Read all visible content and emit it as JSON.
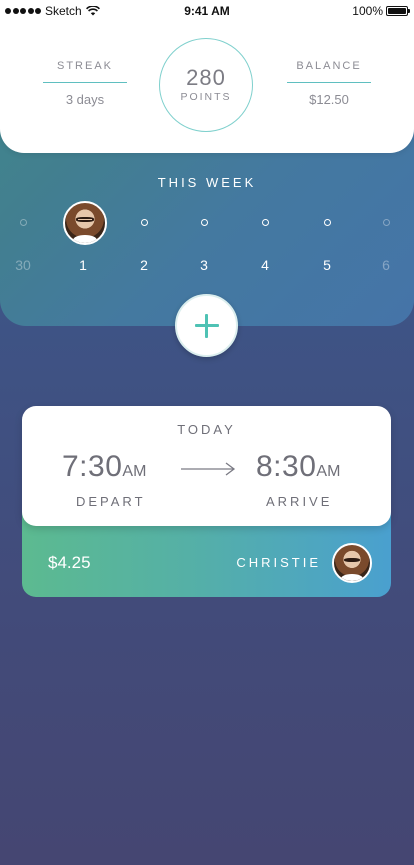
{
  "status_bar": {
    "carrier": "Sketch",
    "time": "9:41 AM",
    "battery": "100%"
  },
  "stats": {
    "streak_label": "STREAK",
    "streak_value": "3 days",
    "points_value": "280",
    "points_label": "POINTS",
    "balance_label": "BALANCE",
    "balance_value": "$12.50"
  },
  "week": {
    "title": "THIS WEEK",
    "days": [
      {
        "num": "30",
        "faded": true,
        "active": false
      },
      {
        "num": "1",
        "faded": false,
        "active": true
      },
      {
        "num": "2",
        "faded": false,
        "active": false
      },
      {
        "num": "3",
        "faded": false,
        "active": false
      },
      {
        "num": "4",
        "faded": false,
        "active": false
      },
      {
        "num": "5",
        "faded": false,
        "active": false
      },
      {
        "num": "6",
        "faded": true,
        "active": false
      }
    ]
  },
  "trip": {
    "label": "TODAY",
    "depart_time": "7:30",
    "depart_ampm": "AM",
    "depart_caption": "DEPART",
    "arrive_time": "8:30",
    "arrive_ampm": "AM",
    "arrive_caption": "ARRIVE",
    "price": "$4.25",
    "driver": "CHRISTIE"
  },
  "colors": {
    "accent": "#4fc2b4",
    "ring": "#7fd0cd",
    "text_gray": "#6f6f78"
  }
}
